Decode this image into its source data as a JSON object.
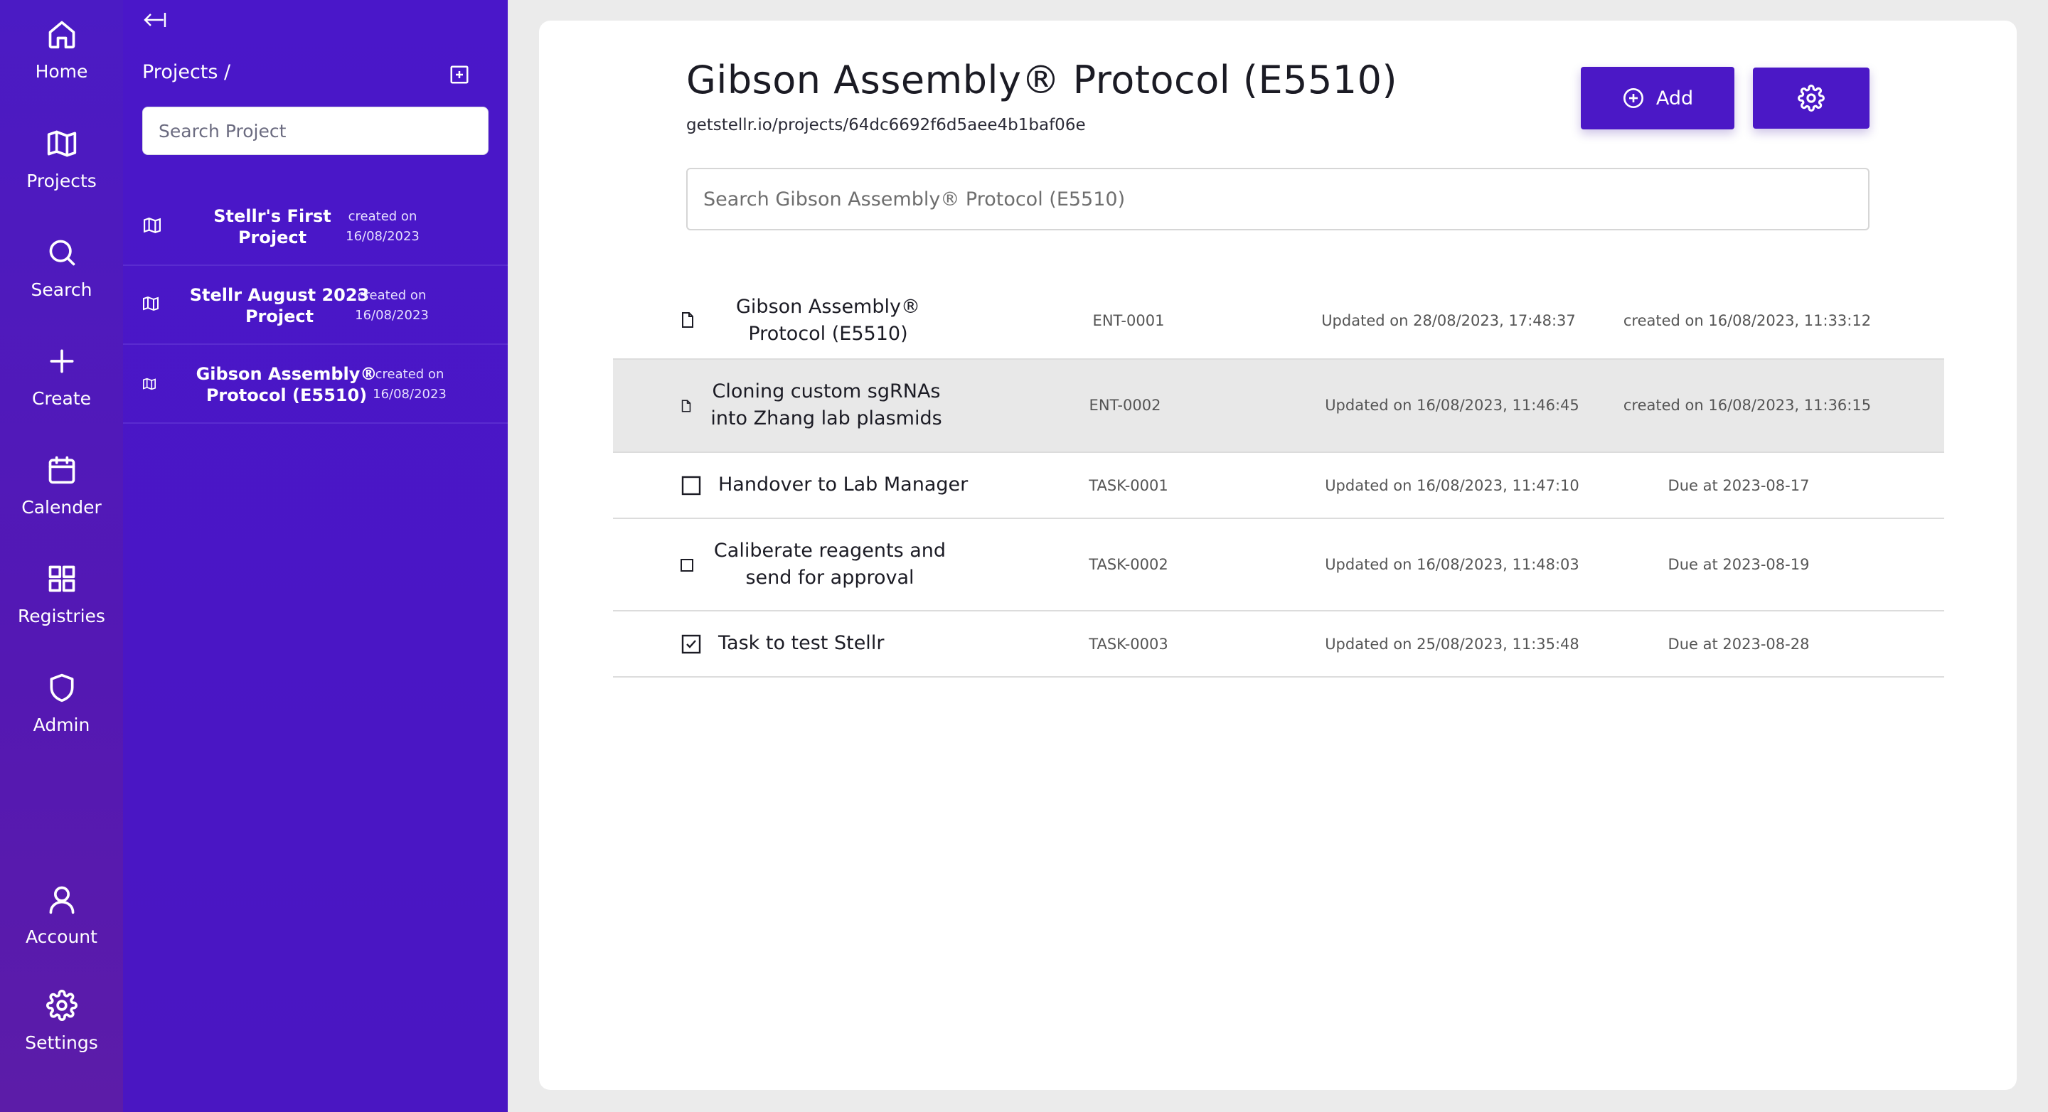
{
  "nav": {
    "items": [
      {
        "label": "Home",
        "icon": "home-icon"
      },
      {
        "label": "Projects",
        "icon": "map-icon"
      },
      {
        "label": "Search",
        "icon": "search-icon"
      },
      {
        "label": "Create",
        "icon": "plus-icon"
      },
      {
        "label": "Calender",
        "icon": "calendar-icon"
      },
      {
        "label": "Registries",
        "icon": "grid-icon"
      },
      {
        "label": "Admin",
        "icon": "shield-icon"
      }
    ],
    "bottom": [
      {
        "label": "Account",
        "icon": "user-icon"
      },
      {
        "label": "Settings",
        "icon": "gear-icon"
      }
    ]
  },
  "panel": {
    "breadcrumb": "Projects /",
    "search_placeholder": "Search Project",
    "projects": [
      {
        "name_line1": "Stellr's First",
        "name_line2": "Project",
        "created_line1": "created on",
        "created_line2": "16/08/2023"
      },
      {
        "name_line1": "Stellr August 2023",
        "name_line2": "Project",
        "created_line1": "created on",
        "created_line2": "16/08/2023"
      },
      {
        "name_line1": "Gibson Assembly®",
        "name_line2": "Protocol (E5510)",
        "created_line1": "created on",
        "created_line2": "16/08/2023"
      }
    ]
  },
  "main": {
    "title": "Gibson Assembly® Protocol (E5510)",
    "url": "getstellr.io/projects/64dc6692f6d5aee4b1baf06e",
    "add_label": "Add",
    "search_placeholder": "Search Gibson Assembly® Protocol (E5510)",
    "rows": [
      {
        "type": "entry",
        "name_line1": "Gibson Assembly®",
        "name_line2": "Protocol (E5510)",
        "id": "ENT-0001",
        "updated": "Updated on 28/08/2023, 17:48:37",
        "meta": "created on 16/08/2023, 11:33:12"
      },
      {
        "type": "entry",
        "name_line1": "Cloning custom sgRNAs",
        "name_line2": "into Zhang lab plasmids",
        "id": "ENT-0002",
        "updated": "Updated on 16/08/2023, 11:46:45",
        "meta": "created on 16/08/2023, 11:36:15"
      },
      {
        "type": "task",
        "name_line1": "Handover to Lab Manager",
        "id": "TASK-0001",
        "updated": "Updated on 16/08/2023, 11:47:10",
        "meta": "Due at 2023-08-17",
        "checked": false
      },
      {
        "type": "task",
        "name_line1": "Caliberate reagents and",
        "name_line2": "send for approval",
        "id": "TASK-0002",
        "updated": "Updated on 16/08/2023, 11:48:03",
        "meta": "Due at 2023-08-19",
        "checked": false
      },
      {
        "type": "task",
        "name_line1": "Task to test Stellr",
        "id": "TASK-0003",
        "updated": "Updated on 25/08/2023, 11:35:48",
        "meta": "Due at 2023-08-28",
        "checked": true
      }
    ]
  },
  "colors": {
    "accent": "#4b18c6",
    "nav_bg": "#5418b3",
    "panel_bg": "#4a17c9",
    "selected_row": "#e8e8e8"
  }
}
